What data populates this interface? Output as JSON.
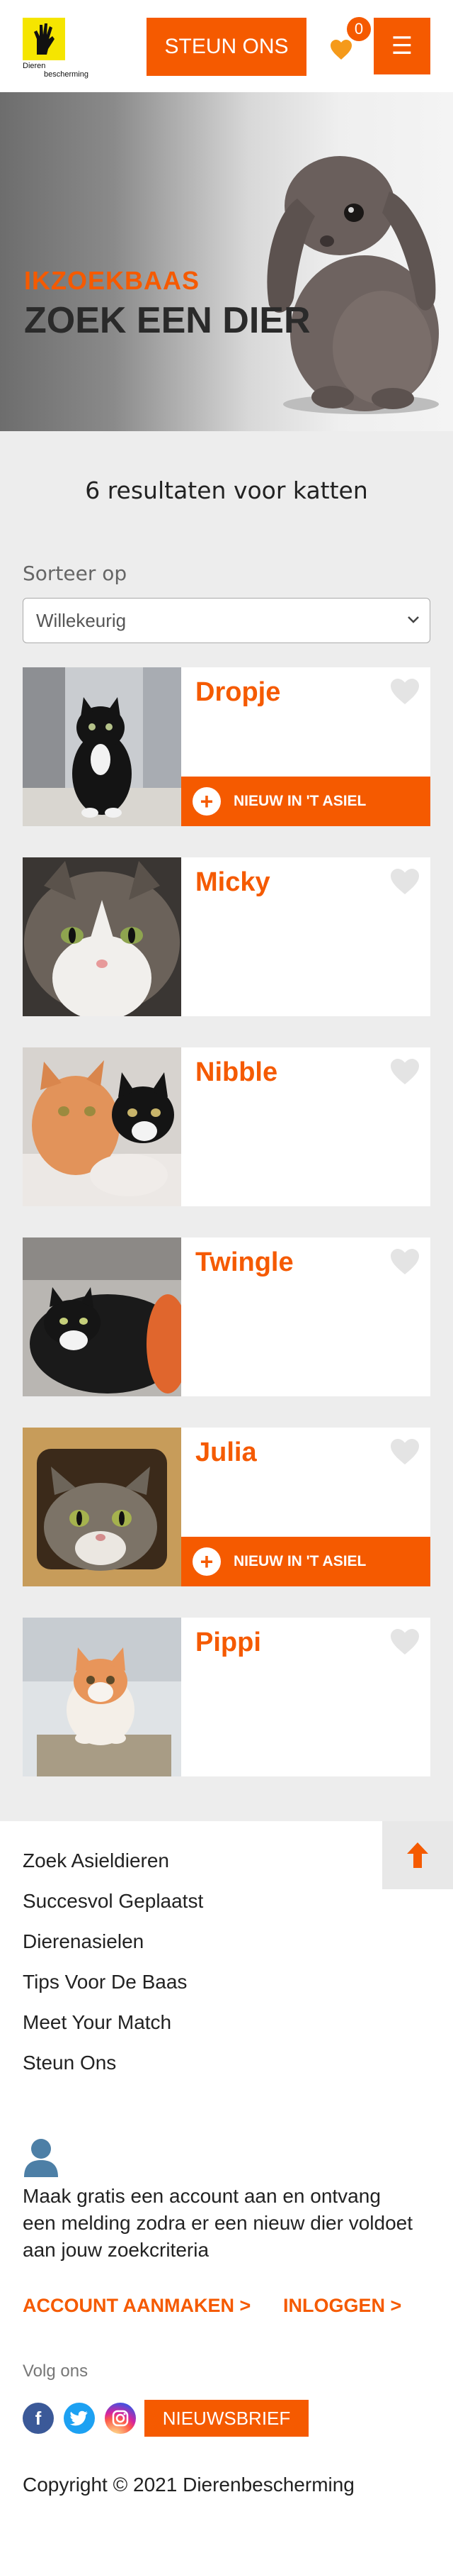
{
  "header": {
    "logo_text_1": "Dieren",
    "logo_text_2": "bescherming",
    "steun_label": "STEUN ONS",
    "favorites_count": "0",
    "menu_icon": "☰"
  },
  "hero": {
    "subtitle": "IKZOEKBAAS",
    "title": "ZOEK EEN DIER"
  },
  "results": {
    "title": "6 resultaten voor katten",
    "sort_label": "Sorteer op",
    "sort_value": "Willekeurig"
  },
  "animals": [
    {
      "name": "Dropje",
      "badge": "NIEUW IN 'T ASIEL"
    },
    {
      "name": "Micky"
    },
    {
      "name": "Nibble"
    },
    {
      "name": "Twingle"
    },
    {
      "name": "Julia",
      "badge": "NIEUW IN 'T ASIEL"
    },
    {
      "name": "Pippi"
    }
  ],
  "footer": {
    "links": [
      "Zoek Asieldieren",
      "Succesvol Geplaatst",
      "Dierenasielen",
      "Tips Voor De Baas",
      "Meet Your Match",
      "Steun Ons"
    ],
    "account_text": "Maak gratis een account aan en ontvang een melding zodra er een nieuw dier voldoet aan jouw zoekcriteria",
    "create_account": "ACCOUNT AANMAKEN >",
    "login": "INLOGGEN >",
    "follow_label": "Volg ons",
    "newsletter": "NIEUWSBRIEF",
    "copyright": "Copyright © 2021 Dierenbescherming"
  },
  "colors": {
    "accent": "#f55a00",
    "logo_yellow": "#f5e500"
  }
}
